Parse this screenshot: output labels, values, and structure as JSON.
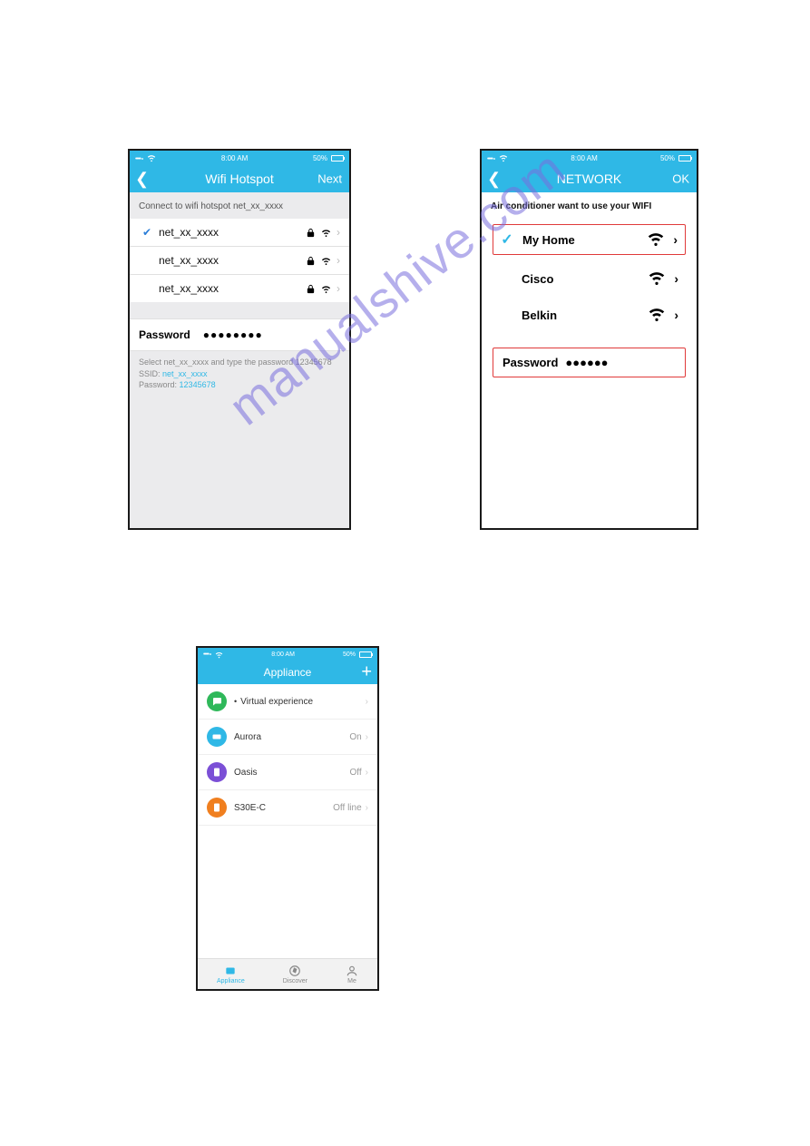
{
  "status": {
    "time": "8:00 AM",
    "battery": "50%"
  },
  "phone1": {
    "title": "Wifi Hotspot",
    "action": "Next",
    "connect_msg": "Connect to wifi hotspot net_xx_xxxx",
    "networks": [
      {
        "name": "net_xx_xxxx",
        "selected": true
      },
      {
        "name": "net_xx_xxxx",
        "selected": false
      },
      {
        "name": "net_xx_xxxx",
        "selected": false
      }
    ],
    "password_label": "Password",
    "password_mask": "●●●●●●●●",
    "hint_line1_a": "Select net_xx_xxxx and type the password 12345678",
    "hint_ssid_label": "SSID:",
    "hint_ssid_value": "net_xx_xxxx",
    "hint_pwd_label": "Password:",
    "hint_pwd_value": "12345678"
  },
  "phone2": {
    "title": "NETWORK",
    "action": "OK",
    "msg": "Air conditioner want to use your WIFI",
    "networks": [
      {
        "name": "My Home",
        "selected": true
      },
      {
        "name": "Cisco",
        "selected": false
      },
      {
        "name": "Belkin",
        "selected": false
      }
    ],
    "password_label": "Password",
    "password_mask": "●●●●●●"
  },
  "phone3": {
    "title": "Appliance",
    "items": [
      {
        "name": "Virtual experience",
        "status": "",
        "color": "green",
        "bullet": true
      },
      {
        "name": "Aurora",
        "status": "On",
        "color": "blue",
        "bullet": false
      },
      {
        "name": "Oasis",
        "status": "Off",
        "color": "purple",
        "bullet": false
      },
      {
        "name": "S30E-C",
        "status": "Off line",
        "color": "orange",
        "bullet": false
      }
    ],
    "tabs": [
      {
        "label": "Appliance",
        "active": true
      },
      {
        "label": "Discover",
        "active": false
      },
      {
        "label": "Me",
        "active": false
      }
    ]
  },
  "watermark": "manualshive.com"
}
